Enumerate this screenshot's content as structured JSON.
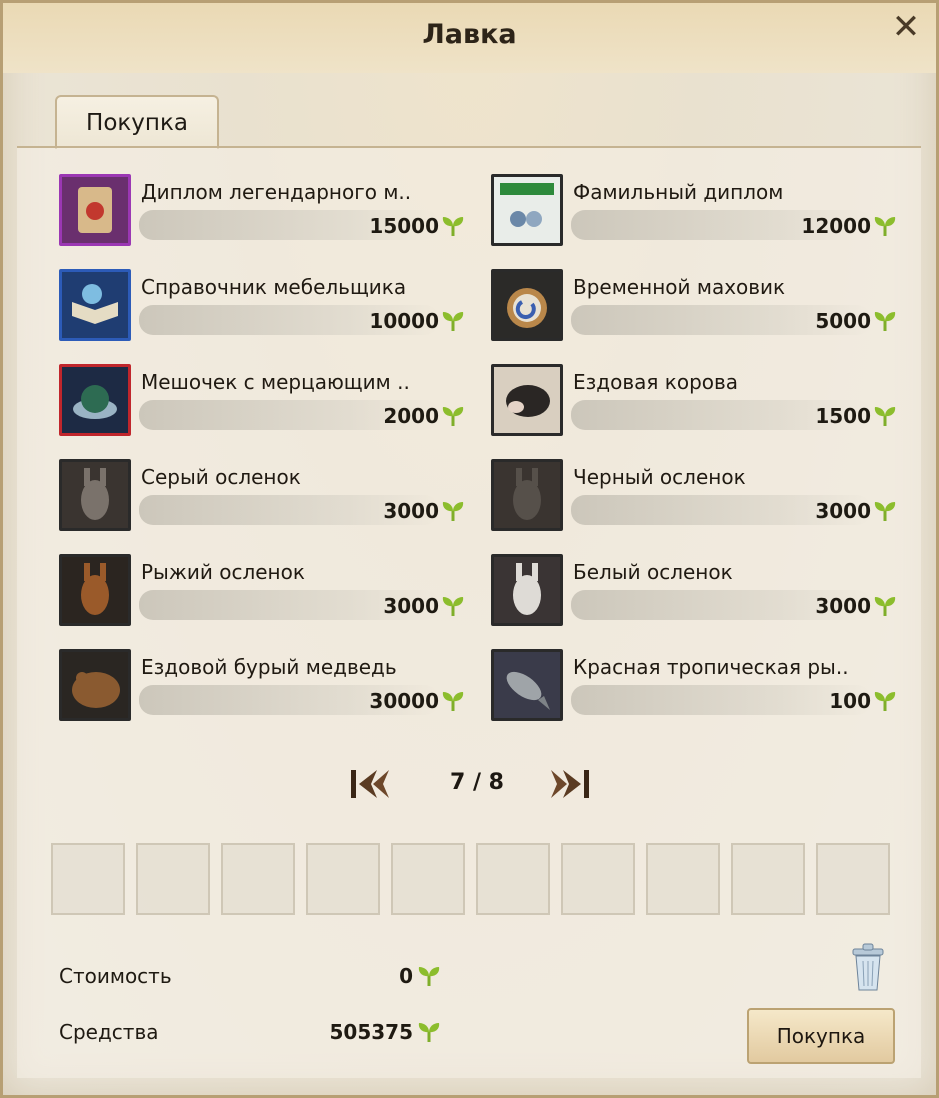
{
  "window": {
    "title": "Лавка"
  },
  "tabs": [
    {
      "label": "Покупка"
    }
  ],
  "items": [
    {
      "name": "Диплом легендарного м..",
      "price": "15000",
      "icon": "legendary-diploma-icon",
      "border": "#9b37b3"
    },
    {
      "name": "Фамильный диплом",
      "price": "12000",
      "icon": "family-diploma-icon",
      "border": "#2a2a2a"
    },
    {
      "name": "Справочник мебельщика",
      "price": "10000",
      "icon": "furniture-handbook-icon",
      "border": "#2c5bb8"
    },
    {
      "name": "Временной маховик",
      "price": "5000",
      "icon": "time-turner-icon",
      "border": "#2a2a2a"
    },
    {
      "name": "Мешочек с мерцающим ..",
      "price": "2000",
      "icon": "shimmering-pouch-icon",
      "border": "#c0262c"
    },
    {
      "name": "Ездовая корова",
      "price": "1500",
      "icon": "riding-cow-icon",
      "border": "#2a2a2a"
    },
    {
      "name": "Серый осленок",
      "price": "3000",
      "icon": "gray-donkey-icon",
      "border": "#2a2a2a"
    },
    {
      "name": "Черный осленок",
      "price": "3000",
      "icon": "black-donkey-icon",
      "border": "#2a2a2a"
    },
    {
      "name": "Рыжий осленок",
      "price": "3000",
      "icon": "red-donkey-icon",
      "border": "#2a2a2a"
    },
    {
      "name": "Белый осленок",
      "price": "3000",
      "icon": "white-donkey-icon",
      "border": "#2a2a2a"
    },
    {
      "name": "Ездовой бурый медведь",
      "price": "30000",
      "icon": "brown-bear-icon",
      "border": "#2a2a2a"
    },
    {
      "name": "Красная тропическая ры..",
      "price": "100",
      "icon": "tropical-fish-icon",
      "border": "#2a2a2a"
    }
  ],
  "pagination": {
    "current": "7",
    "total": "8",
    "display": "7 / 8"
  },
  "summary": {
    "cost_label": "Стоимость",
    "cost_value": "0",
    "funds_label": "Средства",
    "funds_value": "505375"
  },
  "buy_button": {
    "label": "Покупка"
  },
  "colors": {
    "leaf": "#7fae2a",
    "accent": "#b79f74"
  }
}
